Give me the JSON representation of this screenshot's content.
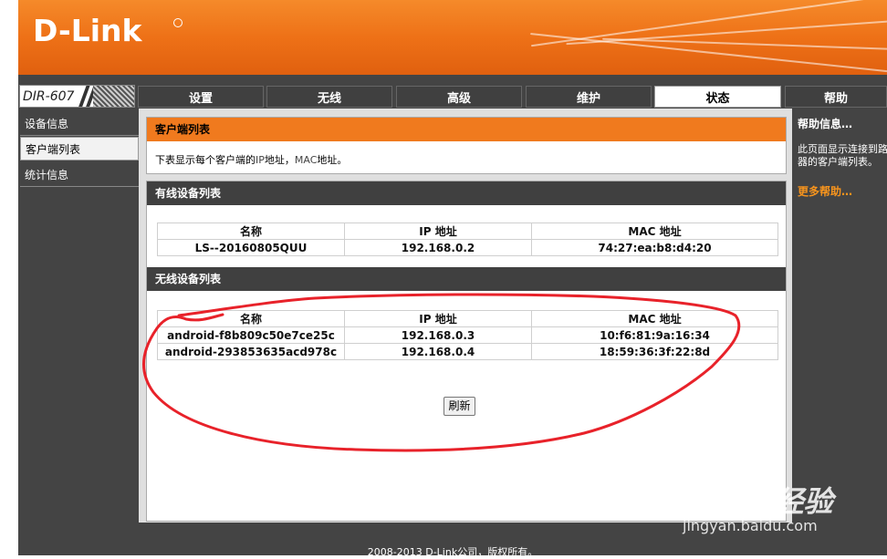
{
  "brand": {
    "logo": "D-Link",
    "model": "DIR-607"
  },
  "nav": {
    "tabs": [
      {
        "label": "设置"
      },
      {
        "label": "无线"
      },
      {
        "label": "高级"
      },
      {
        "label": "维护"
      },
      {
        "label": "状态",
        "active": true
      },
      {
        "label": "帮助"
      }
    ]
  },
  "sidebar": {
    "items": [
      {
        "label": "设备信息"
      },
      {
        "label": "客户端列表",
        "active": true
      },
      {
        "label": "统计信息"
      }
    ]
  },
  "main": {
    "title": "客户端列表",
    "description_before": "下表显示每个客户端的",
    "description_ip": "IP",
    "description_mid": "地址，",
    "description_mac": "MAC",
    "description_after": "地址。",
    "wired": {
      "title": "有线设备列表",
      "columns": [
        "名称",
        "IP 地址",
        "MAC 地址"
      ],
      "rows": [
        [
          "LS--20160805QUU",
          "192.168.0.2",
          "74:27:ea:b8:d4:20"
        ]
      ]
    },
    "wireless": {
      "title": "无线设备列表",
      "columns": [
        "名称",
        "IP 地址",
        "MAC 地址"
      ],
      "rows": [
        [
          "android-f8b809c50e7ce25c",
          "192.168.0.3",
          "10:f6:81:9a:16:34"
        ],
        [
          "android-293853635acd978c",
          "192.168.0.4",
          "18:59:36:3f:22:8d"
        ]
      ]
    },
    "refresh_label": "刷新"
  },
  "help": {
    "title": "帮助信息…",
    "text": "此页面显示连接到路由器的客户端列表。",
    "more": "更多帮助…"
  },
  "footer": {
    "copyright": "2008-2013 D-Link公司，版权所有。"
  },
  "watermark": {
    "main": "Baidu经验",
    "sub": "jingyan.baidu.com"
  },
  "colors": {
    "header_orange": "#ee7117",
    "panel_dark": "#404040",
    "accent_orange": "#f07a1e",
    "annotation_red": "#e8222a"
  }
}
